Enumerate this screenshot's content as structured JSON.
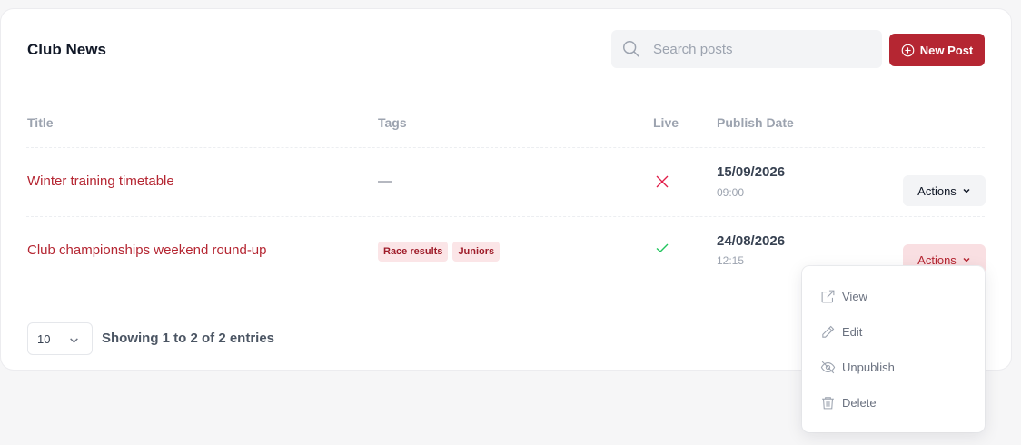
{
  "card": {
    "title": "Club News"
  },
  "search": {
    "placeholder": "Search posts",
    "value": ""
  },
  "new_post_label": "New Post",
  "columns": [
    "Title",
    "Tags",
    "Live",
    "Publish Date"
  ],
  "posts": [
    {
      "title": "Winter training timetable",
      "tags": [],
      "tags_empty": "—",
      "live": false,
      "date": "15/09/2026",
      "time": "09:00",
      "actions_label": "Actions"
    },
    {
      "title": "Club championships weekend round-up",
      "tags": [
        "Race results",
        "Juniors"
      ],
      "live": true,
      "date": "24/08/2026",
      "time": "12:15",
      "actions_label": "Actions"
    }
  ],
  "pagination": {
    "page_size": "10",
    "summary": "Showing 1 to 2 of 2 entries"
  },
  "actions_menu": {
    "items": [
      "View",
      "Edit",
      "Unpublish",
      "Delete"
    ]
  },
  "colors": {
    "accent": "#b52632",
    "live_on": "#22c55e",
    "live_off": "#e11d48",
    "tag_bg": "#fbe5e7"
  }
}
